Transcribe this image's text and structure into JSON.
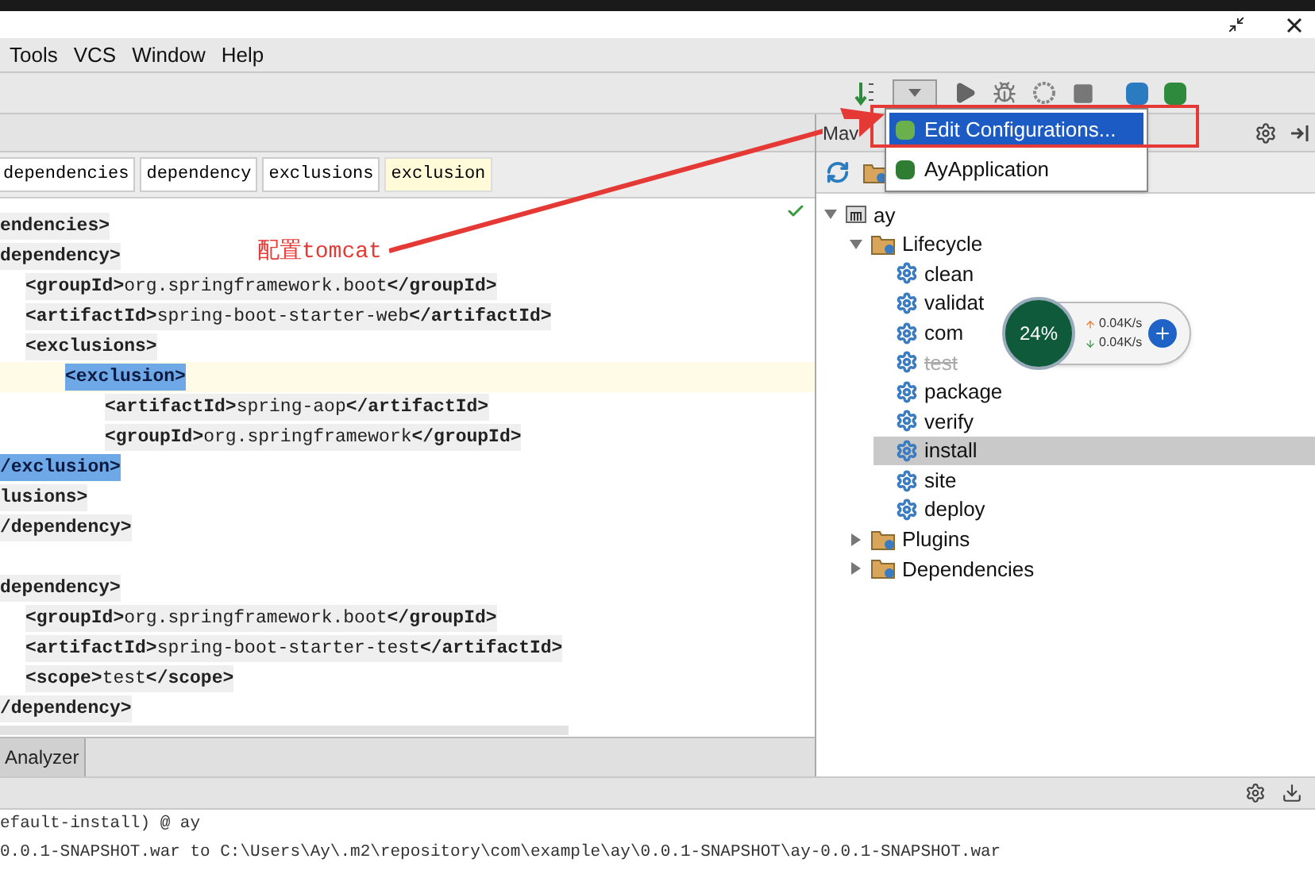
{
  "menu_bar": [
    "Tools",
    "VCS",
    "Window",
    "Help"
  ],
  "breadcrumbs": [
    {
      "label": "dependencies",
      "selected": false
    },
    {
      "label": "dependency",
      "selected": false
    },
    {
      "label": "exclusions",
      "selected": false
    },
    {
      "label": "exclusion",
      "selected": true
    }
  ],
  "editor": {
    "lines": [
      {
        "kind": "code",
        "text": "**endencies>**",
        "current": false,
        "matched": false
      },
      {
        "kind": "code",
        "text": "**dependency>**",
        "current": false,
        "matched": false,
        "children": [
          {
            "kind": "code",
            "text": "**<groupId>**org.springframework.boot**</groupId>**",
            "current": false,
            "matched": false
          },
          {
            "kind": "code",
            "text": "**<artifactId>**spring-boot-starter-web**</artifactId>**",
            "current": false,
            "matched": false
          },
          {
            "kind": "code",
            "text": "**<exclusions>**",
            "current": false,
            "matched": false,
            "children": [
              {
                "kind": "code",
                "text": "**<exclusion>**",
                "current": true,
                "matched": true,
                "children": [
                  {
                    "kind": "code",
                    "text": "**<artifactId>**spring-aop**</artifactId>**",
                    "current": false,
                    "matched": false
                  },
                  {
                    "kind": "code",
                    "text": "**<groupId>**org.springframework**</groupId>**",
                    "current": false,
                    "matched": false
                  }
                ]
              }
            ]
          }
        ]
      },
      {
        "kind": "code",
        "text": "**/exclusion>**",
        "current": false,
        "matched": true
      },
      {
        "kind": "code",
        "text": "**lusions>**",
        "current": false,
        "matched": false
      },
      {
        "kind": "code",
        "text": "**/dependency>**",
        "current": false,
        "matched": false
      },
      {
        "kind": "blank"
      },
      {
        "kind": "code",
        "text": "**dependency>**",
        "current": false,
        "matched": false,
        "children": [
          {
            "kind": "code",
            "text": "**<groupId>**org.springframework.boot**</groupId>**",
            "current": false,
            "matched": false
          },
          {
            "kind": "code",
            "text": "**<artifactId>**spring-boot-starter-test**</artifactId>**",
            "current": false,
            "matched": false
          },
          {
            "kind": "code",
            "text": "**<scope>**test**</scope>**",
            "current": false,
            "matched": false
          }
        ]
      },
      {
        "kind": "code",
        "text": "**/dependency>**",
        "current": false,
        "matched": false
      }
    ]
  },
  "annotation": "配置tomcat",
  "bottom_tab": "Analyzer",
  "maven_panel": {
    "title": "Mav",
    "tree": [
      {
        "label": "ay",
        "kind": "project",
        "expanded": true,
        "children": [
          {
            "label": "Lifecycle",
            "kind": "folder",
            "expanded": true,
            "children": [
              {
                "label": "clean",
                "kind": "goal",
                "selected": false,
                "disabled": false
              },
              {
                "label": "validat",
                "kind": "goal",
                "selected": false,
                "disabled": false
              },
              {
                "label": "com",
                "kind": "goal",
                "selected": false,
                "disabled": false
              },
              {
                "label": "test",
                "kind": "goal",
                "selected": false,
                "disabled": true
              },
              {
                "label": "package",
                "kind": "goal",
                "selected": false,
                "disabled": false
              },
              {
                "label": "verify",
                "kind": "goal",
                "selected": false,
                "disabled": false
              },
              {
                "label": "install",
                "kind": "goal",
                "selected": true,
                "disabled": false
              },
              {
                "label": "site",
                "kind": "goal",
                "selected": false,
                "disabled": false
              },
              {
                "label": "deploy",
                "kind": "goal",
                "selected": false,
                "disabled": false
              }
            ]
          },
          {
            "label": "Plugins",
            "kind": "folder",
            "expanded": false
          },
          {
            "label": "Dependencies",
            "kind": "folder",
            "expanded": false
          }
        ]
      }
    ]
  },
  "run_menu": [
    {
      "label": "Edit Configurations...",
      "selected": true
    },
    {
      "label": "AyApplication",
      "selected": false
    }
  ],
  "speed_widget": {
    "percent": "24%",
    "upload": "0.04K/s",
    "download": "0.04K/s"
  },
  "console": [
    "efault-install) @ ay",
    "0.0.1-SNAPSHOT.war to C:\\Users\\Ay\\.m2\\repository\\com\\example\\ay\\0.0.1-SNAPSHOT\\ay-0.0.1-SNAPSHOT.war"
  ]
}
